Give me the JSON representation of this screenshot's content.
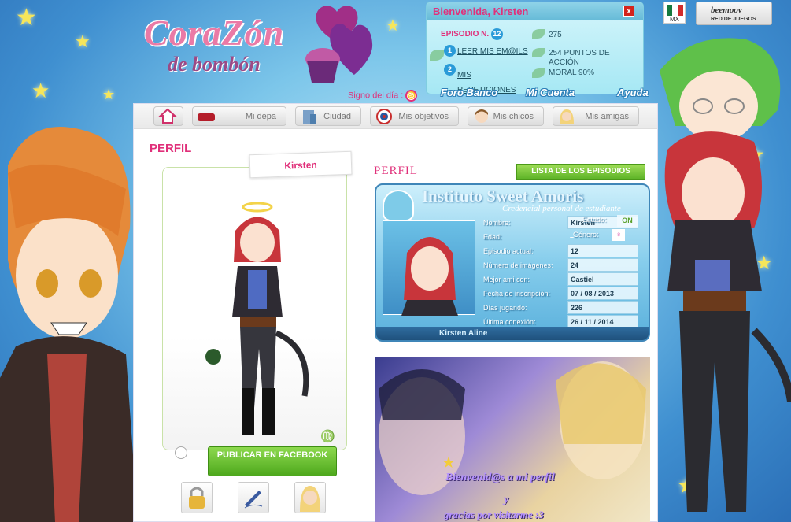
{
  "logo": {
    "line1": "CoraZón",
    "line2": "de bombón"
  },
  "signo": {
    "label": "Signo del día :"
  },
  "welcome": {
    "title": "Bienvenida, Kirsten",
    "close": "x",
    "episode_label": "EPISODIO N.",
    "episode_num": "12",
    "dollars": "275",
    "action_points": "254 PUNTOS DE ACCIÓN",
    "moral": "MORAL 90%",
    "emails_count": "1",
    "emails_label": "LEER MIS EM@ILS",
    "reps_count": "2",
    "reps_label": "MIS REPETICIONES"
  },
  "country": {
    "code": "MX"
  },
  "partner": {
    "name": "beemoov",
    "subtitle": "RED DE JUEGOS"
  },
  "top_links": {
    "forum": "Foro Banco",
    "account": "Mi Cuenta",
    "help": "Ayuda"
  },
  "nav": {
    "home": "",
    "depa": "Mi depa",
    "ciudad": "Ciudad",
    "objetivos": "Mis objetivos",
    "chicos": "Mis chicos",
    "amigas": "Mis amigas"
  },
  "profile": {
    "title": "PERFIL",
    "name_tab": "Kirsten",
    "fb_button": "PUBLICAR EN FACEBOOK",
    "section_title": "PERFIL",
    "episodes_button": "LISTA DE LOS EPISODIOS"
  },
  "card": {
    "title": "Instituto Sweet Amoris",
    "subtitle": "Credencial personal de estudiante",
    "estado_label": "Estado:",
    "estado_value": "ON",
    "genero_label": "Género:",
    "genero_value": "♀",
    "fields": [
      {
        "k": "Nombre:",
        "v": "Kirsten"
      },
      {
        "k": "Edad:",
        "v": "–"
      },
      {
        "k": "Episodio actual:",
        "v": "12"
      },
      {
        "k": "Número de imágenes:",
        "v": "24"
      },
      {
        "k": "Mejor ami con:",
        "v": "Castiel"
      },
      {
        "k": "Fecha de inscripción:",
        "v": "07 / 08 / 2013"
      },
      {
        "k": "Días jugando:",
        "v": "226"
      },
      {
        "k": "Última conexión:",
        "v": "26 / 11 / 2014"
      }
    ],
    "fullname": "Kirsten Aline"
  },
  "banner": {
    "line1": "Bienvenid@s a mi perfil",
    "line2": "y",
    "line3": "gracias por visitarme :3"
  }
}
